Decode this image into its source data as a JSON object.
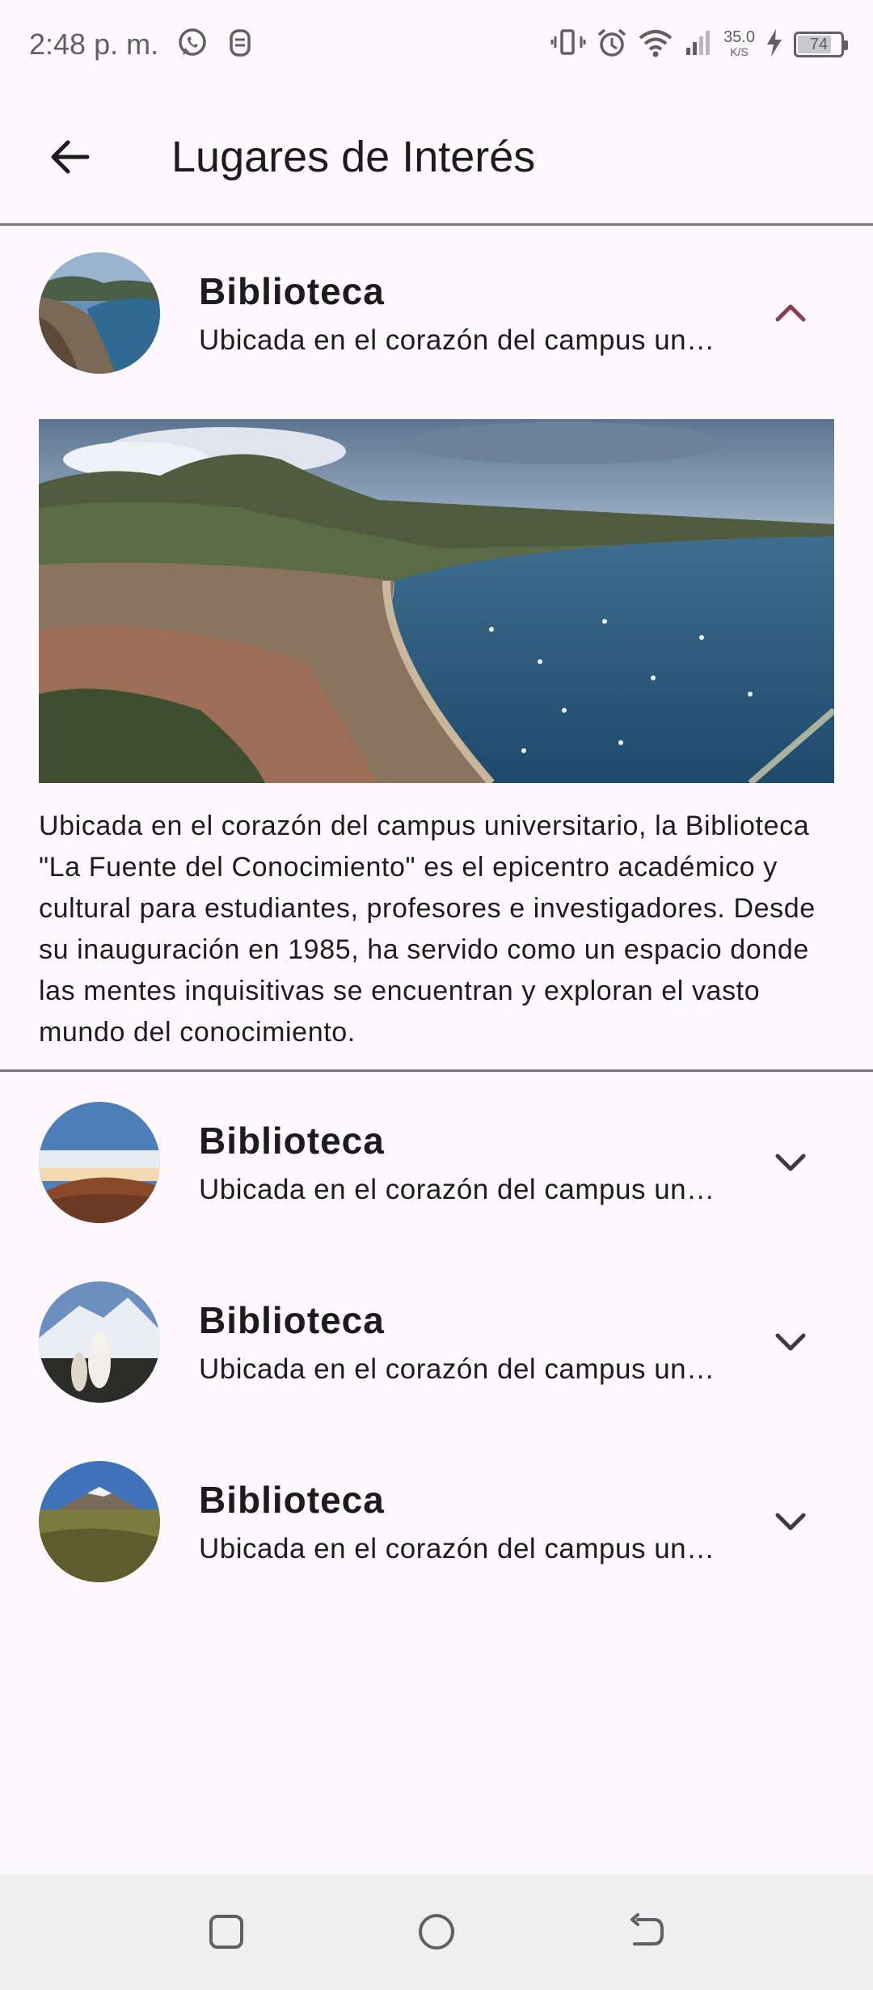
{
  "status_bar": {
    "time": "2:48 p. m.",
    "net_speed_value": "35.0",
    "net_speed_unit": "K/S",
    "battery_level": "74",
    "icons": [
      "whatsapp-icon",
      "notification-icon",
      "vibrate-icon",
      "alarm-icon",
      "wifi-icon",
      "signal-icon",
      "charging-icon",
      "battery-icon"
    ]
  },
  "app_bar": {
    "title": "Lugares de Interés",
    "back_icon": "arrow-back-icon"
  },
  "places": [
    {
      "title": "Biblioteca",
      "subtitle": "Ubicada en el corazón del campus universitario, la Biblioteca \"La Fuente del Conocimiento\" es el epicentro académico y cultural para estudiantes, profesores e investigadores.",
      "expanded": true,
      "description": "Ubicada en el corazón del campus universitario, la Biblioteca \"La Fuente del Conocimiento\" es el epicentro académico y cultural para estudiantes, profesores e investigadores. Desde su inauguración en 1985, ha servido como un espacio donde las mentes inquisitivas se encuentran y exploran el vasto mundo del conocimiento."
    },
    {
      "title": "Biblioteca",
      "subtitle": "Ubicada en el corazón del campus universitario, la Biblioteca \"La Fuente del Conocimiento\" es el epicentro académico y cultural para estudiantes, profesores e investigadores.",
      "expanded": false
    },
    {
      "title": "Biblioteca",
      "subtitle": "Ubicada en el corazón del campus universitario, la Biblioteca \"La Fuente del Conocimiento\" es el epicentro académico y cultural para estudiantes, profesores e investigadores.",
      "expanded": false
    },
    {
      "title": "Biblioteca",
      "subtitle": "Ubicada en el corazón del campus universitario, la Biblioteca \"La Fuente del Conocimiento\" es el epicentro académico y cultural para estudiantes, profesores e investigadores.",
      "expanded": false
    }
  ],
  "nav_bar": {
    "icons": [
      "recents-icon",
      "home-icon",
      "back-icon"
    ]
  },
  "colors": {
    "background": "#fdf8fc",
    "accent_chevron_expanded": "#8e3a55",
    "divider": "#79767d",
    "nav_bar": "#efefef"
  }
}
